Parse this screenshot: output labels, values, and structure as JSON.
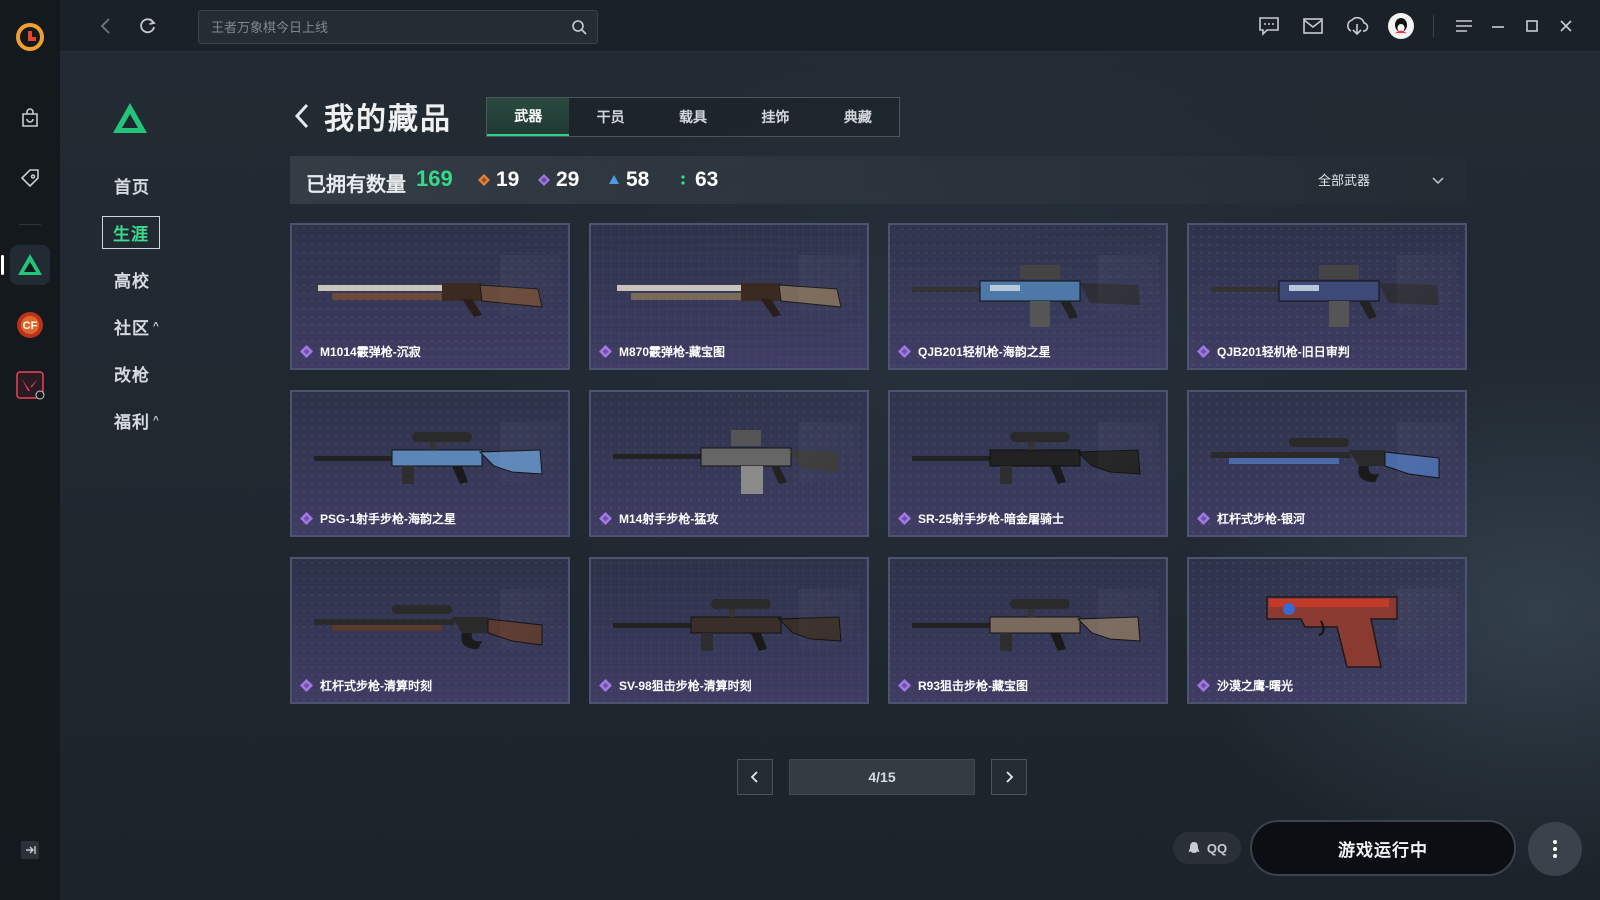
{
  "search": {
    "placeholder": "王者万象棋今日上线"
  },
  "sidebar": {
    "items": [
      {
        "label": "首页",
        "caret": ""
      },
      {
        "label": "生涯",
        "caret": ""
      },
      {
        "label": "高校",
        "caret": ""
      },
      {
        "label": "社区",
        "caret": "^"
      },
      {
        "label": "改枪",
        "caret": ""
      },
      {
        "label": "福利",
        "caret": "^"
      }
    ],
    "active_index": 1
  },
  "page": {
    "title": "我的藏品"
  },
  "tabs": [
    {
      "label": "武器",
      "active": true
    },
    {
      "label": "干员",
      "active": false
    },
    {
      "label": "载具",
      "active": false
    },
    {
      "label": "挂饰",
      "active": false
    },
    {
      "label": "典藏",
      "active": false
    }
  ],
  "stats": {
    "owned_label": "已拥有数量",
    "owned_count": "169",
    "rarities": [
      {
        "icon": "orange-diamond-icon",
        "color": "#e8823a",
        "count": "19"
      },
      {
        "icon": "purple-diamond-icon",
        "color": "#a277e8",
        "count": "29"
      },
      {
        "icon": "blue-triangle-icon",
        "color": "#4a9de6",
        "count": "58"
      },
      {
        "icon": "green-dots-icon",
        "color": "#3ddc8e",
        "count": "63"
      }
    ]
  },
  "filter": {
    "label": "全部武器"
  },
  "items": [
    {
      "name": "M1014霰弹枪-沉寂",
      "weapon": "shotgun"
    },
    {
      "name": "M870霰弹枪-藏宝图",
      "weapon": "shotgun"
    },
    {
      "name": "QJB201轻机枪-海韵之星",
      "weapon": "lmg"
    },
    {
      "name": "QJB201轻机枪-旧日审判",
      "weapon": "lmg"
    },
    {
      "name": "PSG-1射手步枪-海韵之星",
      "weapon": "sniper"
    },
    {
      "name": "M14射手步枪-猛攻",
      "weapon": "rifle"
    },
    {
      "name": "SR-25射手步枪-暗金屠骑士",
      "weapon": "sniper"
    },
    {
      "name": "杠杆式步枪-银河",
      "weapon": "lever"
    },
    {
      "name": "杠杆式步枪-清算时刻",
      "weapon": "lever"
    },
    {
      "name": "SV-98狙击步枪-清算时刻",
      "weapon": "sniper"
    },
    {
      "name": "R93狙击步枪-藏宝图",
      "weapon": "sniper"
    },
    {
      "name": "沙漠之鹰-曙光",
      "weapon": "pistol"
    }
  ],
  "pager": {
    "text": "4/15"
  },
  "footer": {
    "qq_label": "QQ",
    "run_label": "游戏运行中"
  }
}
